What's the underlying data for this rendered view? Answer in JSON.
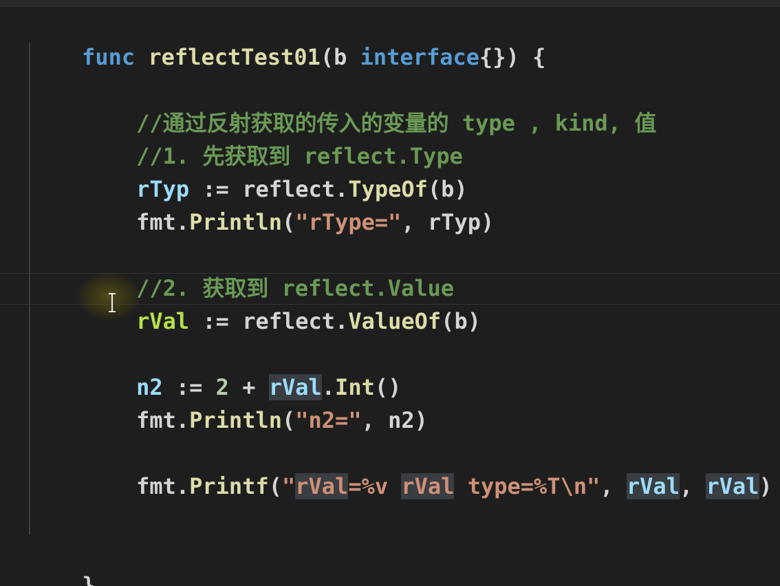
{
  "editor": {
    "lines": {
      "l1": {
        "kw_func": "func",
        "fn_name": "reflectTest01",
        "open": "(b ",
        "kw_interface": "interface",
        "close": "{}) {"
      },
      "l2": {
        "comment": "//通过反射获取的传入的变量的 type , kind, 值"
      },
      "l3": {
        "comment": "//1. 先获取到 reflect.Type"
      },
      "l4": {
        "var": "rTyp",
        "assign": " := reflect.",
        "fn": "TypeOf",
        "args": "(b)"
      },
      "l5": {
        "pkg": "fmt.",
        "fn": "Println",
        "open": "(",
        "str": "\"rType=\"",
        "rest": ", rTyp)"
      },
      "l6": {
        "comment": "//2. 获取到 reflect.Value"
      },
      "l7": {
        "var": "rVal",
        "assign": " := reflect.",
        "fn": "ValueOf",
        "args": "(b)"
      },
      "l8": {
        "var": "n2",
        "op": " := ",
        "num": "2",
        "plus": " + ",
        "hl_var": "rVal",
        "dot": ".",
        "fn": "Int",
        "args": "()"
      },
      "l9": {
        "pkg": "fmt.",
        "fn": "Println",
        "open": "(",
        "str": "\"n2=\"",
        "rest": ", n2)"
      },
      "l10": {
        "pkg": "fmt.",
        "fn": "Printf",
        "open": "(",
        "q": "\"",
        "s1": "rVal",
        "s2": "=%v ",
        "s3": "rVal",
        "s4": " type=%T\\n\"",
        "comma1": ", ",
        "a1": "rVal",
        "comma2": ", ",
        "a2": "rVal",
        "close": ")"
      },
      "l11": {
        "brace": "}"
      }
    }
  },
  "colors": {
    "background": "#1e1e1e",
    "keyword": "#569cd6",
    "function": "#dcdcaa",
    "variable": "#9cdcfe",
    "comment": "#6a9955",
    "string": "#ce9178",
    "number": "#b5cea8",
    "highlight": "#3a3d41"
  }
}
